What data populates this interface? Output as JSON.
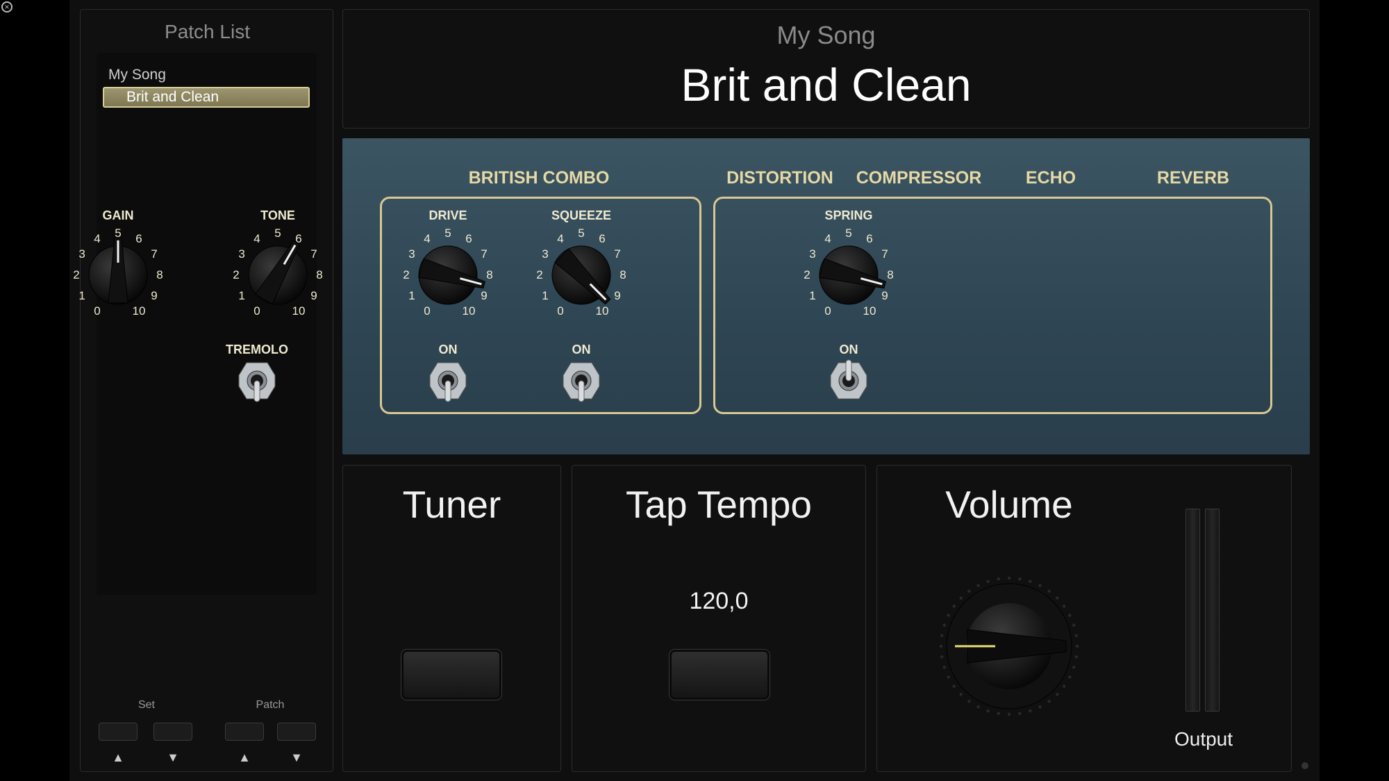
{
  "sidebar": {
    "title": "Patch List",
    "set_name": "My Song",
    "selected_patch": "Brit and Clean",
    "set_label": "Set",
    "patch_label": "Patch",
    "up_arrow": "▲",
    "down_arrow": "▼"
  },
  "header": {
    "song_title": "My Song",
    "patch_title": "Brit and Clean"
  },
  "amp": {
    "sections": [
      "BRITISH COMBO",
      "DISTORTION",
      "COMPRESSOR",
      "ECHO",
      "REVERB"
    ],
    "knobs": [
      {
        "label": "GAIN",
        "value": 5.0
      },
      {
        "label": "TONE",
        "value": 6.0
      },
      {
        "label": "DRIVE",
        "value": 8.5
      },
      {
        "label": "SQUEEZE",
        "value": 9.5
      },
      {
        "label": "SPRING",
        "value": 8.5
      }
    ],
    "scale": [
      "0",
      "1",
      "2",
      "3",
      "4",
      "5",
      "6",
      "7",
      "8",
      "9",
      "10"
    ],
    "toggles": [
      {
        "label": "TREMOLO",
        "state": "down"
      },
      {
        "label": "ON",
        "state": "down"
      },
      {
        "label": "ON",
        "state": "down"
      },
      {
        "label": "ON",
        "state": "up"
      }
    ],
    "colors": {
      "panel": "#34505f",
      "frame": "#d8c992",
      "text": "#e6d9a4"
    }
  },
  "tuner": {
    "title": "Tuner"
  },
  "tap_tempo": {
    "title": "Tap Tempo",
    "bpm": "120,0"
  },
  "volume": {
    "title": "Volume",
    "output_label": "Output",
    "level": 0.2
  }
}
